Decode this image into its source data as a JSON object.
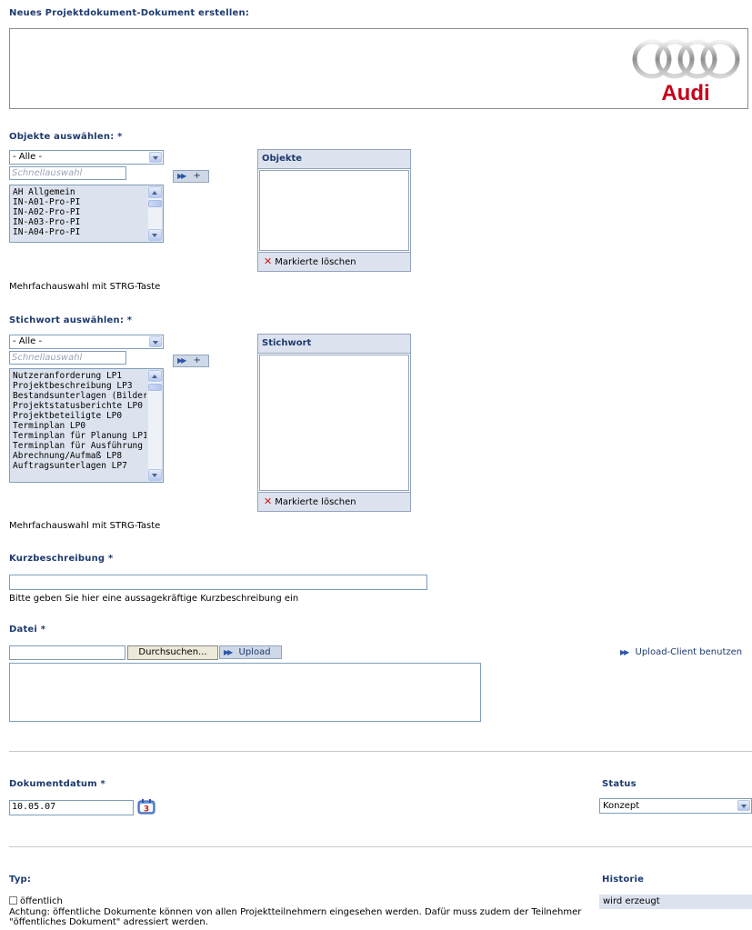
{
  "page": {
    "title": "Neues Projektdokument-Dokument erstellen:"
  },
  "logo": {
    "brand": "Audi"
  },
  "objekte": {
    "heading": "Objekte auswählen: *",
    "filter_value": "- Alle -",
    "quick_placeholder": "Schnellauswahl",
    "add_label": "+",
    "list_items": [
      "AH Allgemein",
      "IN-A01-Pro-PI",
      "IN-A02-Pro-PI",
      "IN-A03-Pro-PI",
      "IN-A04-Pro-PI"
    ],
    "panel_title": "Objekte",
    "delete_label": "Markierte löschen",
    "hint": "Mehrfachauswahl mit STRG-Taste"
  },
  "stichwort": {
    "heading": "Stichwort auswählen: *",
    "filter_value": "- Alle -",
    "quick_placeholder": "Schnellauswahl",
    "add_label": "+",
    "list_items": [
      "Nutzeranforderung LP1",
      "Projektbeschreibung LP3",
      "Bestandsunterlagen (Bilder",
      "Projektstatusberichte LP0",
      "Projektbeteiligte LP0",
      "Terminplan LP0",
      "Terminplan für Planung LP1",
      "Terminplan für Ausführung",
      "Abrechnung/Aufmaß LP8",
      "Auftragsunterlagen LP7"
    ],
    "panel_title": "Stichwort",
    "delete_label": "Markierte löschen",
    "hint": "Mehrfachauswahl mit STRG-Taste"
  },
  "kurz": {
    "heading": "Kurzbeschreibung *",
    "value": "",
    "hint": "Bitte geben Sie hier eine aussagekräftige Kurzbeschreibung ein"
  },
  "datei": {
    "heading": "Datei *",
    "browse_label": "Durchsuchen...",
    "upload_label": "Upload",
    "client_link": "Upload-Client benutzen"
  },
  "datum": {
    "heading": "Dokumentdatum *",
    "value": "10.05.07",
    "calendar_number": "3"
  },
  "status": {
    "heading": "Status",
    "value": "Konzept"
  },
  "typ": {
    "heading": "Typ:",
    "checkbox_label": "öffentlich",
    "checked": false,
    "note": "Achtung: öffentliche Dokumente können von allen Projektteilnehmern eingesehen werden. Dafür muss zudem der Teilnehmer \"öffentliches Dokument\" adressiert werden."
  },
  "historie": {
    "heading": "Historie",
    "value": "wird erzeugt"
  },
  "colors": {
    "heading": "#1d3a6e",
    "panel_bg": "#dde3ee",
    "audi_red": "#c5001a"
  }
}
